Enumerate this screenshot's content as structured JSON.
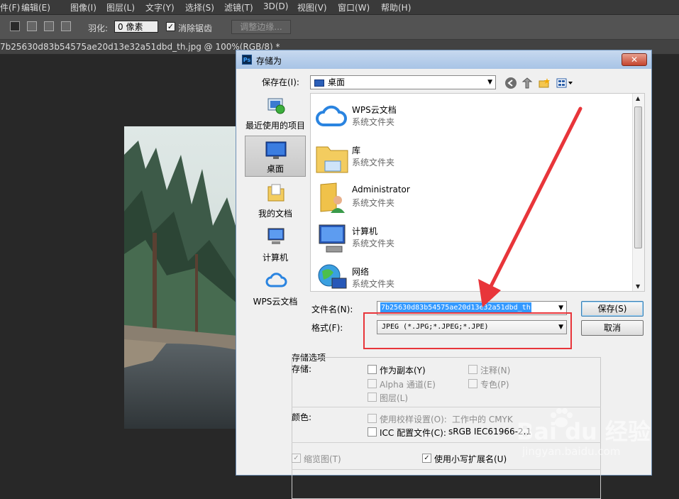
{
  "menubar": {
    "items": [
      "件(F)",
      "编辑(E)",
      "图像(I)",
      "图层(L)",
      "文字(Y)",
      "选择(S)",
      "滤镜(T)",
      "3D(D)",
      "视图(V)",
      "窗口(W)",
      "帮助(H)"
    ]
  },
  "options_bar": {
    "feather_label": "羽化:",
    "feather_value": "0 像素",
    "antialias_label": "消除锯齿",
    "refine_edge_label": "调整边缘..."
  },
  "document_tab": {
    "title": "7b25630d83b54575ae20d13e32a51dbd_th.jpg @ 100%(RGB/8) *"
  },
  "dialog": {
    "title": "存储为",
    "close_glyph": "✕",
    "save_in_label": "保存在(I):",
    "save_in_value": "桌面",
    "places": [
      "最近使用的项目",
      "桌面",
      "我的文档",
      "计算机",
      "WPS云文档"
    ],
    "files": [
      {
        "name": "WPS云文档",
        "type": "系统文件夹"
      },
      {
        "name": "库",
        "type": "系统文件夹"
      },
      {
        "name": "Administrator",
        "type": "系统文件夹"
      },
      {
        "name": "计算机",
        "type": "系统文件夹"
      },
      {
        "name": "网络",
        "type": "系统文件夹"
      }
    ],
    "filename_label": "文件名(N):",
    "filename_value": "7b25630d83b54575ae20d13e32a51dbd_th",
    "format_label": "格式(F):",
    "format_value": "JPEG (*.JPG;*.JPEG;*.JPE)",
    "save_button": "保存(S)",
    "cancel_button": "取消",
    "options": {
      "group_title": "存储选项",
      "storage_label": "存储:",
      "as_copy": "作为副本(Y)",
      "annotations": "注释(N)",
      "alpha": "Alpha 通道(E)",
      "spot": "专色(P)",
      "layers": "图层(L)",
      "color_label": "颜色:",
      "proof": "使用校样设置(O):",
      "proof_value": "工作中的 CMYK",
      "icc": "ICC 配置文件(C):",
      "icc_value": "sRGB IEC61966-2.1",
      "thumbnail": "缩览图(T)",
      "lowercase_ext": "使用小写扩展名(U)"
    }
  },
  "watermark": {
    "brand": "Bai du 经验",
    "url": "jingyan.baidu.com"
  },
  "colors": {
    "highlight_box": "#e8353a",
    "arrow": "#e8353a",
    "selection": "#3399ff"
  }
}
